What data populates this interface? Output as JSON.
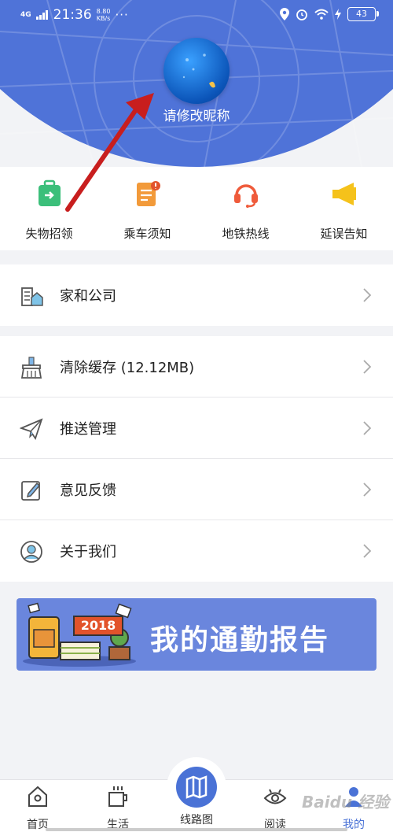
{
  "status_bar": {
    "network": "4G",
    "time": "21:36",
    "speed": "8.80\nKB/s",
    "dots": "···",
    "battery": "43"
  },
  "profile": {
    "nickname": "请修改昵称"
  },
  "quick_actions": [
    {
      "label": "失物招领",
      "icon": "luggage-icon",
      "color": "#3bbf7a"
    },
    {
      "label": "乘车须知",
      "icon": "notice-icon",
      "color": "#f29a3a"
    },
    {
      "label": "地铁热线",
      "icon": "headset-icon",
      "color": "#ef5b3b"
    },
    {
      "label": "延误告知",
      "icon": "megaphone-icon",
      "color": "#f5c21b"
    }
  ],
  "menu_group_1": [
    {
      "label": "家和公司",
      "icon": "home-office-icon"
    }
  ],
  "menu_group_2": [
    {
      "label": "清除缓存 (12.12MB)",
      "icon": "broom-icon"
    },
    {
      "label": "推送管理",
      "icon": "paper-plane-icon"
    },
    {
      "label": "意见反馈",
      "icon": "edit-icon"
    },
    {
      "label": "关于我们",
      "icon": "user-circle-icon"
    }
  ],
  "banner": {
    "year": "2018",
    "title": "我的通勤报告"
  },
  "tab_bar": {
    "home": "首页",
    "life": "生活",
    "map": "线路图",
    "read": "阅读",
    "mine": "我的"
  },
  "watermark": "Baidu 经验",
  "colors": {
    "header_blue": "#4f73d8",
    "banner_blue": "#6a86dd",
    "annotation_red": "#c81e1e"
  }
}
